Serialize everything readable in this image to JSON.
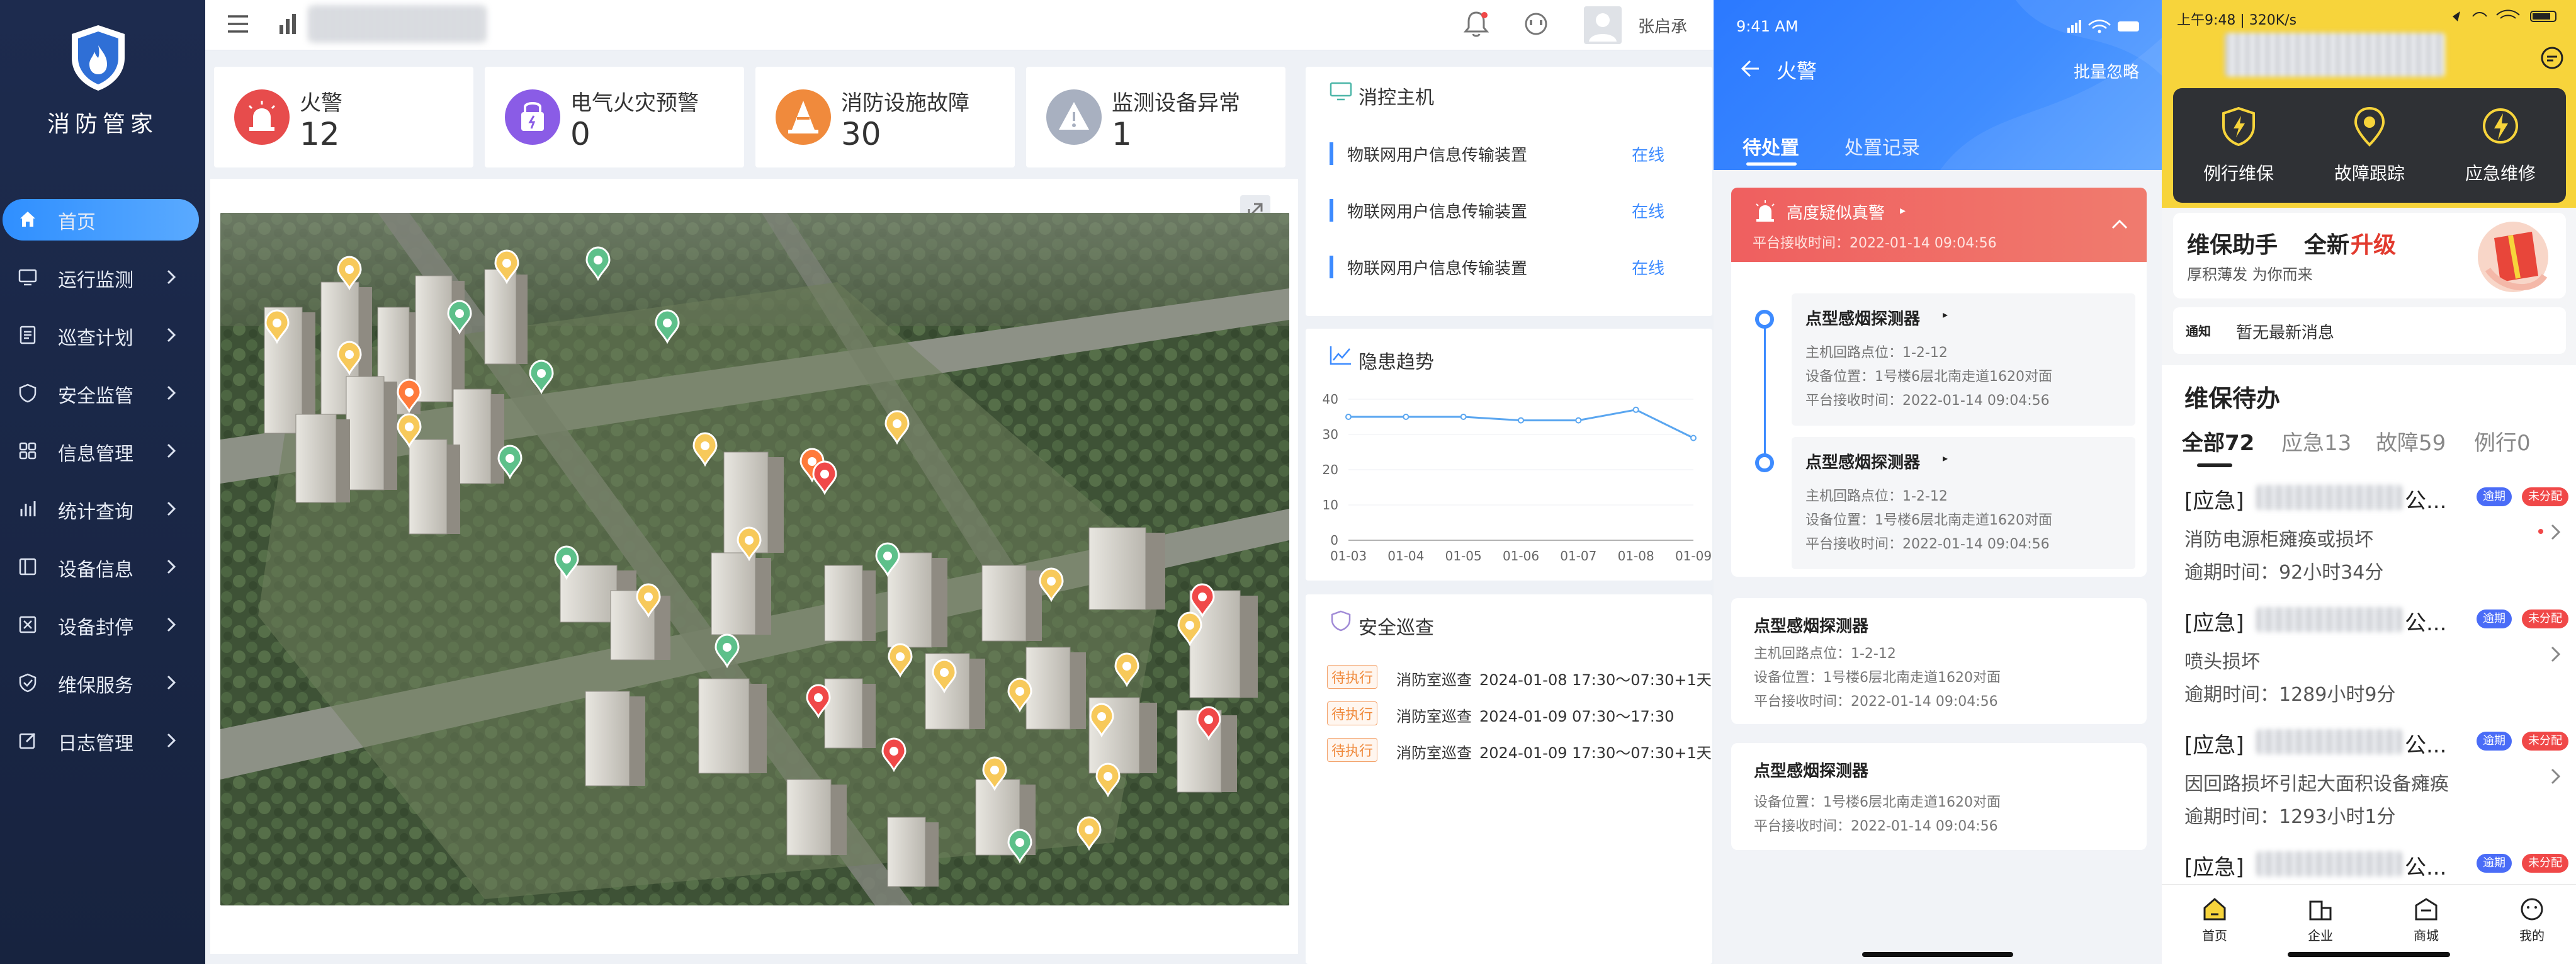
{
  "sidebar": {
    "brand": "消防管家",
    "items": [
      {
        "label": "首页"
      },
      {
        "label": "运行监测"
      },
      {
        "label": "巡查计划"
      },
      {
        "label": "安全监管"
      },
      {
        "label": "信息管理"
      },
      {
        "label": "统计查询"
      },
      {
        "label": "设备信息"
      },
      {
        "label": "设备封停"
      },
      {
        "label": "维保服务"
      },
      {
        "label": "日志管理"
      }
    ]
  },
  "header": {
    "user_name": "张启承"
  },
  "stats": [
    {
      "label": "火警",
      "value": "12",
      "color": "#e74c4c"
    },
    {
      "label": "电气火灾预警",
      "value": "0",
      "color": "#8a5ce6"
    },
    {
      "label": "消防设施故障",
      "value": "30",
      "color": "#f08a3c"
    },
    {
      "label": "监测设备异常",
      "value": "1",
      "color": "#a8b0c0"
    }
  ],
  "control_host": {
    "title": "消控主机",
    "rows": [
      {
        "name": "物联网用户信息传输装置",
        "status": "在线"
      },
      {
        "name": "物联网用户信息传输装置",
        "status": "在线"
      },
      {
        "name": "物联网用户信息传输装置",
        "status": "在线"
      }
    ]
  },
  "chart_data": {
    "type": "line",
    "title": "隐患趋势",
    "categories": [
      "01-03",
      "01-04",
      "01-05",
      "01-06",
      "01-07",
      "01-08",
      "01-09"
    ],
    "series": [
      {
        "values": [
          35,
          35,
          35,
          34,
          34,
          37,
          29
        ]
      }
    ],
    "yticks": [
      "0",
      "10",
      "20",
      "30",
      "40"
    ],
    "ylim": [
      0,
      40
    ],
    "color": "#5aa6f0"
  },
  "patrol": {
    "title": "安全巡查",
    "rows": [
      {
        "tag": "待执行",
        "name": "消防室巡查",
        "time": "2024-01-08 17:30～07:30+1天"
      },
      {
        "tag": "待执行",
        "name": "消防室巡查",
        "time": "2024-01-09 07:30～17:30"
      },
      {
        "tag": "待执行",
        "name": "消防室巡查",
        "time": "2024-01-09 17:30～07:30+1天"
      }
    ]
  },
  "phone1": {
    "status_time": "9:41 AM",
    "title": "火警",
    "action": "批量忽略",
    "tabs": [
      "待处置",
      "处置记录"
    ],
    "alert": {
      "title": "高度疑似真警",
      "time": "平台接收时间：2022-01-14 09:04:56"
    },
    "timeline": [
      {
        "title": "点型感烟探测器",
        "l1": "主机回路点位：1-2-12",
        "l2": "设备位置：1号楼6层北南走道1620对面",
        "l3": "平台接收时间：2022-01-14 09:04:56"
      },
      {
        "title": "点型感烟探测器",
        "l1": "主机回路点位：1-2-12",
        "l2": "设备位置：1号楼6层北南走道1620对面",
        "l3": "平台接收时间：2022-01-14 09:04:56"
      }
    ],
    "cards": [
      {
        "title": "点型感烟探测器",
        "l1": "主机回路点位：1-2-12",
        "l2": "设备位置：1号楼6层北南走道1620对面",
        "l3": "平台接收时间：2022-01-14 09:04:56"
      },
      {
        "title": "点型感烟探测器",
        "l1": "设备位置：1号楼6层北南走道1620对面",
        "l2": "平台接收时间：2022-01-14 09:04:56"
      }
    ]
  },
  "phone2": {
    "status": "上午9:48 | 320K/s",
    "tools": [
      "例行维保",
      "故障跟踪",
      "应急维修"
    ],
    "banner": {
      "title1": "维保助手",
      "title2": "全新",
      "title3": "升级",
      "subtitle": "厚积薄发 为你而来"
    },
    "news": "暂无最新消息",
    "todo_title": "维保待办",
    "tabs": [
      "全部72",
      "应急13",
      "故障59",
      "例行0"
    ],
    "items": [
      {
        "prefix": "[应急]",
        "suffix": "公...",
        "badge1": "逾期",
        "badge2": "未分配",
        "desc": "消防电源柜瘫痪或损坏",
        "time": "逾期时间：92小时34分"
      },
      {
        "prefix": "[应急]",
        "suffix": "公...",
        "badge1": "逾期",
        "badge2": "未分配",
        "desc": "喷头损坏",
        "time": "逾期时间：1289小时9分"
      },
      {
        "prefix": "[应急]",
        "suffix": "公...",
        "badge1": "逾期",
        "badge2": "未分配",
        "desc": "因回路损坏引起大面积设备瘫痪",
        "time": "逾期时间：1293小时1分"
      },
      {
        "prefix": "[应急]",
        "suffix": "公...",
        "badge1": "逾期",
        "badge2": "未分配"
      }
    ],
    "bottom_nav": [
      "首页",
      "企业",
      "商城",
      "我的"
    ],
    "badge_blue": "#4a6cf7",
    "badge_red": "#f04848"
  }
}
